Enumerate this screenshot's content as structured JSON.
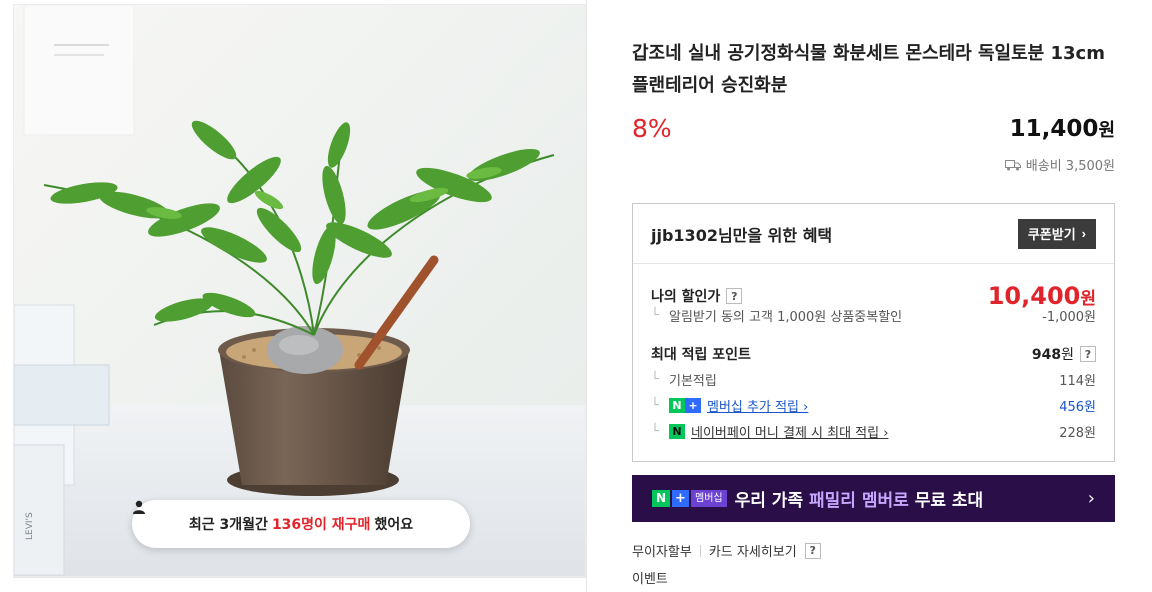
{
  "repurchase": {
    "prefix": "최근 3개월간",
    "highlight": "136명이 재구매",
    "suffix": "했어요"
  },
  "product": {
    "title": "갑조네 실내 공기정화식물 화분세트 몬스테라 독일토분 13cm 플랜테리어 승진화분",
    "discount": "8%",
    "price": "11,400",
    "price_unit": "원",
    "shipping": "배송비 3,500원"
  },
  "benefit": {
    "title": "jjb1302님만을 위한 혜택",
    "coupon_label": "쿠폰받기",
    "my_price_label": "나의 할인가",
    "my_price": "10,400",
    "my_price_unit": "원",
    "alarm_discount_label": "알림받기 동의 고객 1,000원 상품중복할인",
    "alarm_discount_value": "-1,000원",
    "max_points_label": "최대 적립 포인트",
    "max_points": "948",
    "max_points_unit": "원",
    "basic_points_label": "기본적립",
    "basic_points_value": "114원",
    "membership_points_label": "멤버십 추가 적립",
    "membership_points_value": "456원",
    "npay_points_label": "네이버페이 머니 결제 시 최대 적립",
    "npay_points_value": "228원"
  },
  "membership_banner": {
    "badge_n": "N",
    "badge_plus": "+",
    "badge_text": "멤버십",
    "text_a": "우리 가족 ",
    "text_accent": "패밀리 멤버로",
    "text_b": " 무료 초대"
  },
  "payment": {
    "installment": "무이자할부",
    "card_details": "카드 자세히보기"
  },
  "event_label": "이벤트",
  "colors": {
    "accent_red": "#e1242b",
    "naver_green": "#03c75a",
    "banner_bg": "#2a0e48"
  }
}
